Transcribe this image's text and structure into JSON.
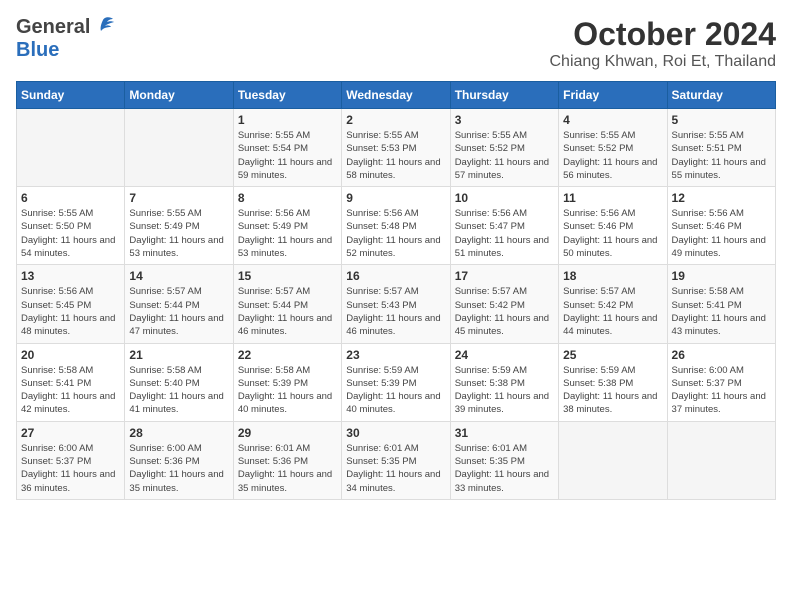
{
  "header": {
    "logo_general": "General",
    "logo_blue": "Blue",
    "month": "October 2024",
    "location": "Chiang Khwan, Roi Et, Thailand"
  },
  "weekdays": [
    "Sunday",
    "Monday",
    "Tuesday",
    "Wednesday",
    "Thursday",
    "Friday",
    "Saturday"
  ],
  "weeks": [
    [
      {
        "day": "",
        "sunrise": "",
        "sunset": "",
        "daylight": ""
      },
      {
        "day": "",
        "sunrise": "",
        "sunset": "",
        "daylight": ""
      },
      {
        "day": "1",
        "sunrise": "Sunrise: 5:55 AM",
        "sunset": "Sunset: 5:54 PM",
        "daylight": "Daylight: 11 hours and 59 minutes."
      },
      {
        "day": "2",
        "sunrise": "Sunrise: 5:55 AM",
        "sunset": "Sunset: 5:53 PM",
        "daylight": "Daylight: 11 hours and 58 minutes."
      },
      {
        "day": "3",
        "sunrise": "Sunrise: 5:55 AM",
        "sunset": "Sunset: 5:52 PM",
        "daylight": "Daylight: 11 hours and 57 minutes."
      },
      {
        "day": "4",
        "sunrise": "Sunrise: 5:55 AM",
        "sunset": "Sunset: 5:52 PM",
        "daylight": "Daylight: 11 hours and 56 minutes."
      },
      {
        "day": "5",
        "sunrise": "Sunrise: 5:55 AM",
        "sunset": "Sunset: 5:51 PM",
        "daylight": "Daylight: 11 hours and 55 minutes."
      }
    ],
    [
      {
        "day": "6",
        "sunrise": "Sunrise: 5:55 AM",
        "sunset": "Sunset: 5:50 PM",
        "daylight": "Daylight: 11 hours and 54 minutes."
      },
      {
        "day": "7",
        "sunrise": "Sunrise: 5:55 AM",
        "sunset": "Sunset: 5:49 PM",
        "daylight": "Daylight: 11 hours and 53 minutes."
      },
      {
        "day": "8",
        "sunrise": "Sunrise: 5:56 AM",
        "sunset": "Sunset: 5:49 PM",
        "daylight": "Daylight: 11 hours and 53 minutes."
      },
      {
        "day": "9",
        "sunrise": "Sunrise: 5:56 AM",
        "sunset": "Sunset: 5:48 PM",
        "daylight": "Daylight: 11 hours and 52 minutes."
      },
      {
        "day": "10",
        "sunrise": "Sunrise: 5:56 AM",
        "sunset": "Sunset: 5:47 PM",
        "daylight": "Daylight: 11 hours and 51 minutes."
      },
      {
        "day": "11",
        "sunrise": "Sunrise: 5:56 AM",
        "sunset": "Sunset: 5:46 PM",
        "daylight": "Daylight: 11 hours and 50 minutes."
      },
      {
        "day": "12",
        "sunrise": "Sunrise: 5:56 AM",
        "sunset": "Sunset: 5:46 PM",
        "daylight": "Daylight: 11 hours and 49 minutes."
      }
    ],
    [
      {
        "day": "13",
        "sunrise": "Sunrise: 5:56 AM",
        "sunset": "Sunset: 5:45 PM",
        "daylight": "Daylight: 11 hours and 48 minutes."
      },
      {
        "day": "14",
        "sunrise": "Sunrise: 5:57 AM",
        "sunset": "Sunset: 5:44 PM",
        "daylight": "Daylight: 11 hours and 47 minutes."
      },
      {
        "day": "15",
        "sunrise": "Sunrise: 5:57 AM",
        "sunset": "Sunset: 5:44 PM",
        "daylight": "Daylight: 11 hours and 46 minutes."
      },
      {
        "day": "16",
        "sunrise": "Sunrise: 5:57 AM",
        "sunset": "Sunset: 5:43 PM",
        "daylight": "Daylight: 11 hours and 46 minutes."
      },
      {
        "day": "17",
        "sunrise": "Sunrise: 5:57 AM",
        "sunset": "Sunset: 5:42 PM",
        "daylight": "Daylight: 11 hours and 45 minutes."
      },
      {
        "day": "18",
        "sunrise": "Sunrise: 5:57 AM",
        "sunset": "Sunset: 5:42 PM",
        "daylight": "Daylight: 11 hours and 44 minutes."
      },
      {
        "day": "19",
        "sunrise": "Sunrise: 5:58 AM",
        "sunset": "Sunset: 5:41 PM",
        "daylight": "Daylight: 11 hours and 43 minutes."
      }
    ],
    [
      {
        "day": "20",
        "sunrise": "Sunrise: 5:58 AM",
        "sunset": "Sunset: 5:41 PM",
        "daylight": "Daylight: 11 hours and 42 minutes."
      },
      {
        "day": "21",
        "sunrise": "Sunrise: 5:58 AM",
        "sunset": "Sunset: 5:40 PM",
        "daylight": "Daylight: 11 hours and 41 minutes."
      },
      {
        "day": "22",
        "sunrise": "Sunrise: 5:58 AM",
        "sunset": "Sunset: 5:39 PM",
        "daylight": "Daylight: 11 hours and 40 minutes."
      },
      {
        "day": "23",
        "sunrise": "Sunrise: 5:59 AM",
        "sunset": "Sunset: 5:39 PM",
        "daylight": "Daylight: 11 hours and 40 minutes."
      },
      {
        "day": "24",
        "sunrise": "Sunrise: 5:59 AM",
        "sunset": "Sunset: 5:38 PM",
        "daylight": "Daylight: 11 hours and 39 minutes."
      },
      {
        "day": "25",
        "sunrise": "Sunrise: 5:59 AM",
        "sunset": "Sunset: 5:38 PM",
        "daylight": "Daylight: 11 hours and 38 minutes."
      },
      {
        "day": "26",
        "sunrise": "Sunrise: 6:00 AM",
        "sunset": "Sunset: 5:37 PM",
        "daylight": "Daylight: 11 hours and 37 minutes."
      }
    ],
    [
      {
        "day": "27",
        "sunrise": "Sunrise: 6:00 AM",
        "sunset": "Sunset: 5:37 PM",
        "daylight": "Daylight: 11 hours and 36 minutes."
      },
      {
        "day": "28",
        "sunrise": "Sunrise: 6:00 AM",
        "sunset": "Sunset: 5:36 PM",
        "daylight": "Daylight: 11 hours and 35 minutes."
      },
      {
        "day": "29",
        "sunrise": "Sunrise: 6:01 AM",
        "sunset": "Sunset: 5:36 PM",
        "daylight": "Daylight: 11 hours and 35 minutes."
      },
      {
        "day": "30",
        "sunrise": "Sunrise: 6:01 AM",
        "sunset": "Sunset: 5:35 PM",
        "daylight": "Daylight: 11 hours and 34 minutes."
      },
      {
        "day": "31",
        "sunrise": "Sunrise: 6:01 AM",
        "sunset": "Sunset: 5:35 PM",
        "daylight": "Daylight: 11 hours and 33 minutes."
      },
      {
        "day": "",
        "sunrise": "",
        "sunset": "",
        "daylight": ""
      },
      {
        "day": "",
        "sunrise": "",
        "sunset": "",
        "daylight": ""
      }
    ]
  ]
}
